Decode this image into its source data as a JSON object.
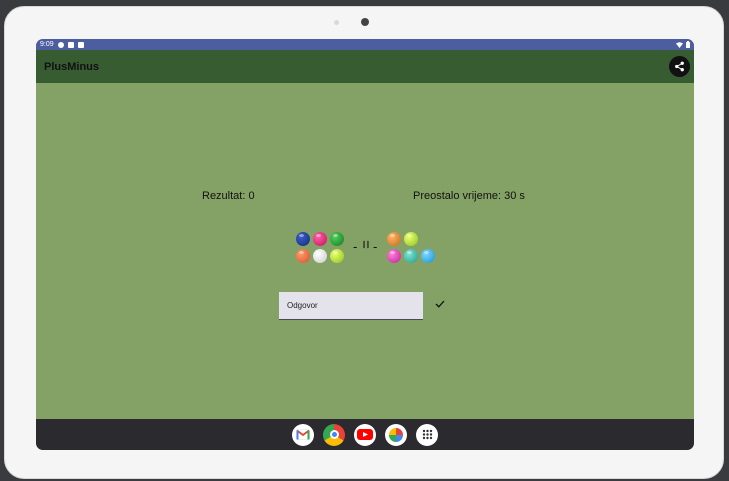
{
  "status_bar": {
    "time": "9:09"
  },
  "app": {
    "title": "PlusMinus"
  },
  "game": {
    "score_text": "Rezultat: 0",
    "time_text": "Preostalo vrijeme: 30 s",
    "operator_left": "-",
    "equals": "=",
    "operator_right": "-",
    "left_balls": [
      "blue",
      "pink",
      "green",
      "orange",
      "white",
      "lime"
    ],
    "right_balls": [
      "orange",
      "lime",
      "magenta",
      "teal",
      "cyan"
    ]
  },
  "answer": {
    "placeholder": "Odgovor"
  },
  "dock": {
    "apps": [
      "gmail-icon",
      "chrome-icon",
      "youtube-icon",
      "photos-icon",
      "app-drawer-icon"
    ]
  },
  "colors": {
    "background": "#84a265",
    "appbar": "#385c32",
    "statusbar": "#4c5ea0"
  }
}
